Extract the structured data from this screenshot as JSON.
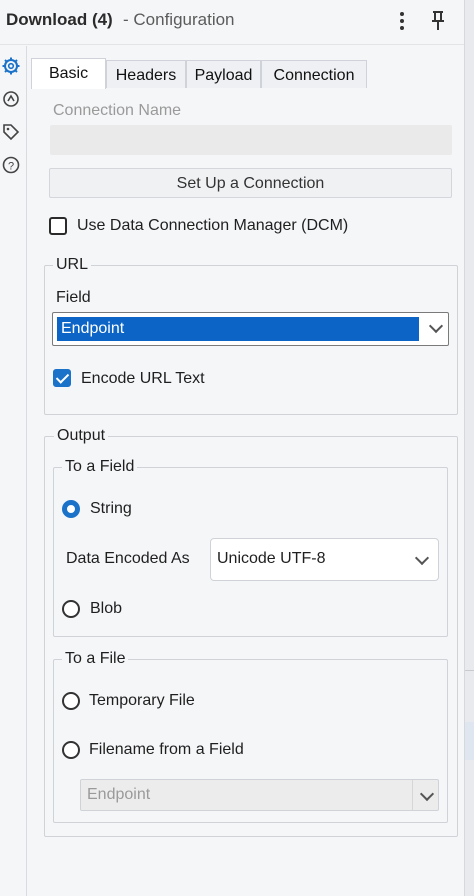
{
  "window": {
    "title_main": "Download (4)",
    "title_sub": "- Configuration"
  },
  "icons": {
    "more": "more-vertical-icon",
    "pin": "pin-icon",
    "rail": [
      "gear-icon",
      "refresh-icon",
      "tag-icon",
      "help-icon"
    ]
  },
  "tabs": [
    {
      "label": "Basic",
      "active": true
    },
    {
      "label": "Headers",
      "active": false
    },
    {
      "label": "Payload",
      "active": false
    },
    {
      "label": "Connection",
      "active": false
    }
  ],
  "basic": {
    "connection_name_label": "Connection Name",
    "connection_name_value": "",
    "setup_button": "Set Up a Connection",
    "dcm_label": "Use Data Connection Manager (DCM)",
    "dcm_checked": false
  },
  "url": {
    "legend": "URL",
    "field_label": "Field",
    "field_value": "Endpoint",
    "encode_label": "Encode URL Text",
    "encode_checked": true
  },
  "output": {
    "legend": "Output",
    "to_field": {
      "legend": "To a Field",
      "string_label": "String",
      "string_selected": true,
      "data_encoded_label": "Data Encoded As",
      "data_encoded_value": "Unicode UTF-8",
      "blob_label": "Blob",
      "blob_selected": false
    },
    "to_file": {
      "legend": "To a File",
      "temporary_label": "Temporary File",
      "temporary_selected": false,
      "filename_label": "Filename from a Field",
      "filename_selected": false,
      "filename_field_value": "Endpoint"
    }
  },
  "colors": {
    "accent": "#1a73c9",
    "selection": "#0b64c6",
    "background": "#f5f6f8"
  }
}
